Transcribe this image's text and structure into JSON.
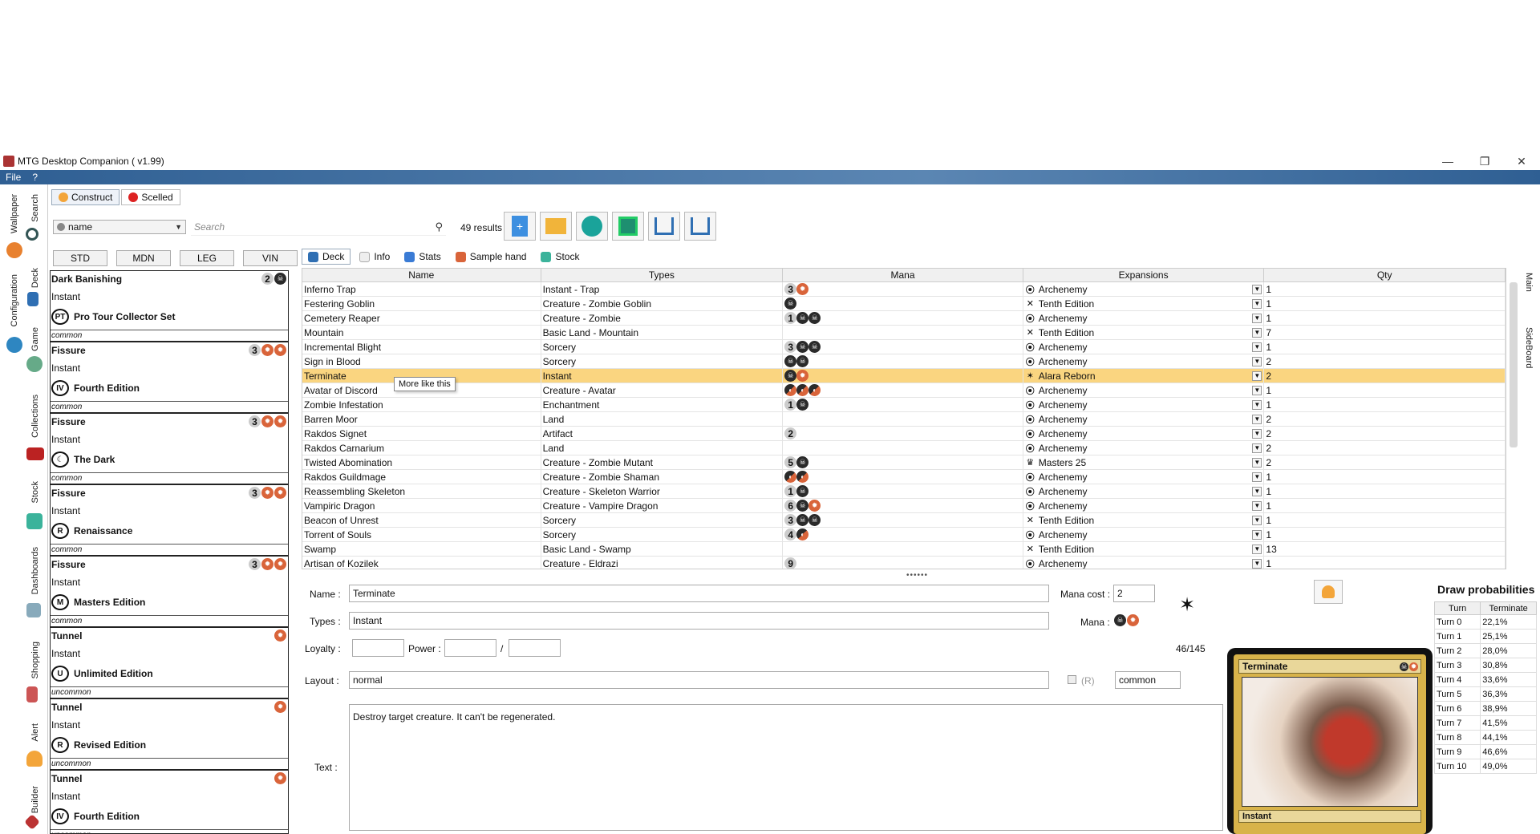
{
  "window": {
    "title": "MTG Desktop Companion ( v1.99)"
  },
  "menu": [
    "File",
    "?"
  ],
  "left_tabs": [
    {
      "label": "Search",
      "icon": "search-icon"
    },
    {
      "label": "Wallpaper",
      "icon": "wallpaper-icon"
    },
    {
      "label": "Deck",
      "icon": "deck-icon"
    },
    {
      "label": "Configuration",
      "icon": "gear-icon"
    },
    {
      "label": "Game",
      "icon": "game-icon"
    },
    {
      "label": "Collections",
      "icon": "collections-icon"
    },
    {
      "label": "Stock",
      "icon": "stock-icon"
    },
    {
      "label": "Dashboards",
      "icon": "dashboard-icon"
    },
    {
      "label": "Shopping",
      "icon": "shopping-icon"
    },
    {
      "label": "Alert",
      "icon": "alert-icon"
    },
    {
      "label": "Builder",
      "icon": "builder-icon"
    }
  ],
  "mode_tabs": [
    "Construct",
    "Scelled"
  ],
  "search": {
    "field": "name",
    "placeholder": "Search",
    "results": "49 results"
  },
  "format_buttons": [
    "STD",
    "MDN",
    "LEG",
    "VIN"
  ],
  "suggestions": [
    {
      "name": "Dark Banishing",
      "mana": [
        "2",
        "B"
      ],
      "type": "Instant",
      "set": "Pro Tour Collector Set",
      "set_icon": "PT",
      "rarity": "common"
    },
    {
      "name": "Fissure",
      "mana": [
        "3",
        "R",
        "R"
      ],
      "type": "Instant",
      "set": "Fourth Edition",
      "set_icon": "IV",
      "rarity": "common"
    },
    {
      "name": "Fissure",
      "mana": [
        "3",
        "R",
        "R"
      ],
      "type": "Instant",
      "set": "The Dark",
      "set_icon": "☾",
      "rarity": "common"
    },
    {
      "name": "Fissure",
      "mana": [
        "3",
        "R",
        "R"
      ],
      "type": "Instant",
      "set": "Renaissance",
      "set_icon": "R",
      "rarity": "common"
    },
    {
      "name": "Fissure",
      "mana": [
        "3",
        "R",
        "R"
      ],
      "type": "Instant",
      "set": "Masters Edition",
      "set_icon": "M",
      "rarity": "common"
    },
    {
      "name": "Tunnel",
      "mana": [
        "R"
      ],
      "type": "Instant",
      "set": "Unlimited Edition",
      "set_icon": "U",
      "rarity": "uncommon"
    },
    {
      "name": "Tunnel",
      "mana": [
        "R"
      ],
      "type": "Instant",
      "set": "Revised Edition",
      "set_icon": "R",
      "rarity": "uncommon"
    },
    {
      "name": "Tunnel",
      "mana": [
        "R"
      ],
      "type": "Instant",
      "set": "Fourth Edition",
      "set_icon": "IV",
      "rarity": "uncommon"
    }
  ],
  "sub_tabs": [
    "Deck",
    "Info",
    "Stats",
    "Sample hand",
    "Stock"
  ],
  "table": {
    "columns": [
      "Name",
      "Types",
      "Mana",
      "Expansions",
      "Qty"
    ],
    "rows": [
      {
        "name": "Inferno Trap",
        "type": "Instant - Trap",
        "mana": [
          "3",
          "R"
        ],
        "exp": "Archenemy",
        "qty": "1"
      },
      {
        "name": "Festering Goblin",
        "type": "Creature - Zombie Goblin",
        "mana": [
          "B"
        ],
        "exp": "Tenth Edition",
        "qty": "1"
      },
      {
        "name": "Cemetery Reaper",
        "type": "Creature - Zombie",
        "mana": [
          "1",
          "B",
          "B"
        ],
        "exp": "Archenemy",
        "qty": "1"
      },
      {
        "name": "Mountain",
        "type": "Basic Land - Mountain",
        "mana": [],
        "exp": "Tenth Edition",
        "qty": "7"
      },
      {
        "name": "Incremental Blight",
        "type": "Sorcery",
        "mana": [
          "3",
          "B",
          "B"
        ],
        "exp": "Archenemy",
        "qty": "1"
      },
      {
        "name": "Sign in Blood",
        "type": "Sorcery",
        "mana": [
          "B",
          "B"
        ],
        "exp": "Archenemy",
        "qty": "2"
      },
      {
        "name": "Terminate",
        "type": "Instant",
        "mana": [
          "B",
          "R"
        ],
        "exp": "Alara Reborn",
        "qty": "2",
        "selected": true
      },
      {
        "name": "Avatar of Discord",
        "type": "Creature - Avatar",
        "mana": [
          "H",
          "H",
          "H"
        ],
        "exp": "Archenemy",
        "qty": "1"
      },
      {
        "name": "Zombie Infestation",
        "type": "Enchantment",
        "mana": [
          "1",
          "B"
        ],
        "exp": "Archenemy",
        "qty": "1"
      },
      {
        "name": "Barren Moor",
        "type": "Land",
        "mana": [],
        "exp": "Archenemy",
        "qty": "2"
      },
      {
        "name": "Rakdos Signet",
        "type": "Artifact",
        "mana": [
          "2"
        ],
        "exp": "Archenemy",
        "qty": "2"
      },
      {
        "name": "Rakdos Carnarium",
        "type": "Land",
        "mana": [],
        "exp": "Archenemy",
        "qty": "2"
      },
      {
        "name": "Twisted Abomination",
        "type": "Creature - Zombie Mutant",
        "mana": [
          "5",
          "B"
        ],
        "exp": "Masters 25",
        "qty": "2"
      },
      {
        "name": "Rakdos Guildmage",
        "type": "Creature - Zombie Shaman",
        "mana": [
          "H",
          "H"
        ],
        "exp": "Archenemy",
        "qty": "1"
      },
      {
        "name": "Reassembling Skeleton",
        "type": "Creature - Skeleton Warrior",
        "mana": [
          "1",
          "B"
        ],
        "exp": "Archenemy",
        "qty": "1"
      },
      {
        "name": "Vampiric Dragon",
        "type": "Creature - Vampire Dragon",
        "mana": [
          "6",
          "B",
          "R"
        ],
        "exp": "Archenemy",
        "qty": "1"
      },
      {
        "name": "Beacon of Unrest",
        "type": "Sorcery",
        "mana": [
          "3",
          "B",
          "B"
        ],
        "exp": "Tenth Edition",
        "qty": "1"
      },
      {
        "name": "Torrent of Souls",
        "type": "Sorcery",
        "mana": [
          "4",
          "H"
        ],
        "exp": "Archenemy",
        "qty": "1"
      },
      {
        "name": "Swamp",
        "type": "Basic Land - Swamp",
        "mana": [],
        "exp": "Tenth Edition",
        "qty": "13"
      },
      {
        "name": "Artisan of Kozilek",
        "type": "Creature - Eldrazi",
        "mana": [
          "9"
        ],
        "exp": "Archenemy",
        "qty": "1"
      }
    ]
  },
  "tooltip": "More like this",
  "right_tabs": [
    "Main",
    "SideBoard"
  ],
  "details": {
    "name_label": "Name :",
    "name": "Terminate",
    "types_label": "Types :",
    "types": "Instant",
    "loyalty_label": "Loyalty :",
    "loyalty": "",
    "power_label": "Power :",
    "power": "",
    "slash": "/",
    "toughness": "",
    "layout_label": "Layout :",
    "layout": "normal",
    "mana_cost_label": "Mana cost :",
    "mana_cost": "2",
    "mana_label": "Mana :",
    "mana": [
      "B",
      "R"
    ],
    "counter": "46/145",
    "reserved_label": "(R)",
    "rarity": "common",
    "text_label": "Text :",
    "text": "Destroy target creature. It can't be regenerated."
  },
  "card_image": {
    "title": "Terminate",
    "type": "Instant",
    "mana": [
      "B",
      "R"
    ]
  },
  "draw_probabilities": {
    "title": "Draw probabilities",
    "columns": [
      "Turn",
      "Terminate"
    ],
    "rows": [
      [
        "Turn 0",
        "22,1%"
      ],
      [
        "Turn 1",
        "25,1%"
      ],
      [
        "Turn 2",
        "28,0%"
      ],
      [
        "Turn 3",
        "30,8%"
      ],
      [
        "Turn 4",
        "33,6%"
      ],
      [
        "Turn 5",
        "36,3%"
      ],
      [
        "Turn 6",
        "38,9%"
      ],
      [
        "Turn 7",
        "41,5%"
      ],
      [
        "Turn 8",
        "44,1%"
      ],
      [
        "Turn 9",
        "46,6%"
      ],
      [
        "Turn 10",
        "49,0%"
      ]
    ]
  }
}
